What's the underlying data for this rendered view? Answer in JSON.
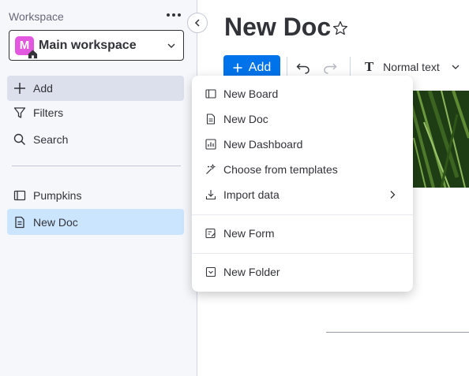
{
  "sidebar": {
    "workspace_label": "Workspace",
    "workspace_name": "Main workspace",
    "workspace_initial": "M",
    "items": [
      {
        "label": "Add",
        "icon": "plus-icon"
      },
      {
        "label": "Filters",
        "icon": "filter-icon"
      },
      {
        "label": "Search",
        "icon": "search-icon"
      }
    ],
    "boards": [
      {
        "label": "Pumpkins",
        "icon": "board-icon"
      },
      {
        "label": "New Doc",
        "icon": "doc-icon",
        "selected": true
      }
    ]
  },
  "main": {
    "doc_title": "New Doc",
    "toolbar": {
      "add_label": "Add",
      "text_type": "Normal text",
      "text_type_glyph": "T"
    }
  },
  "menu": {
    "items": [
      {
        "label": "New Board",
        "icon": "board-icon"
      },
      {
        "label": "New Doc",
        "icon": "doc-icon"
      },
      {
        "label": "New Dashboard",
        "icon": "dashboard-icon"
      },
      {
        "label": "Choose from templates",
        "icon": "magic-wand-icon"
      },
      {
        "label": "Import data",
        "icon": "import-icon",
        "has_submenu": true
      },
      {
        "label": "New Form",
        "icon": "form-icon"
      },
      {
        "label": "New Folder",
        "icon": "folder-icon"
      }
    ]
  },
  "colors": {
    "accent": "#0073ea",
    "selected_bg": "#cce5ff",
    "avatar": "#e259df",
    "sidebar_bg": "#f6f7fb"
  }
}
